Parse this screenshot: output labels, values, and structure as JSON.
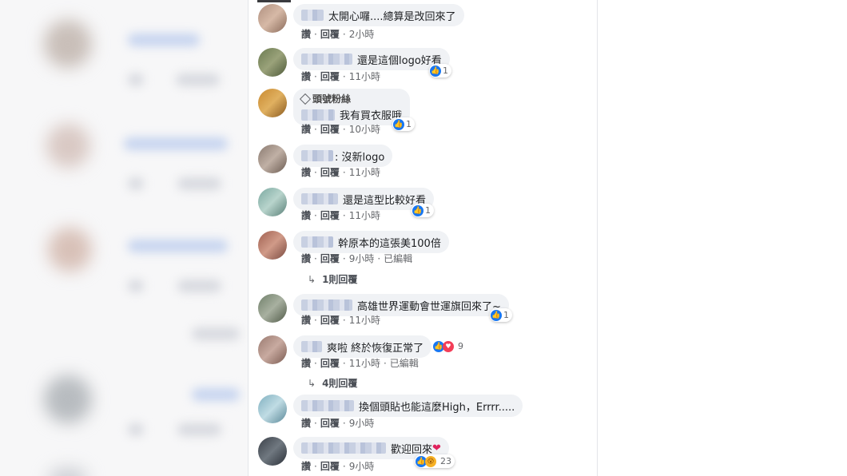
{
  "actions": {
    "like": "讚",
    "reply": "回覆",
    "dot": "·",
    "edited": "已編輯"
  },
  "comments": [
    {
      "badge": "",
      "text": "太開心囉....總算是改回來了",
      "time": "2小時",
      "reactions": ""
    },
    {
      "badge": "",
      "text": "還是這個logo好看",
      "time": "11小時",
      "reactions": "1"
    },
    {
      "badge": "頭號粉絲",
      "text": "我有買衣服哦",
      "time": "10小時",
      "reactions": "1"
    },
    {
      "badge": "",
      "text": ": 沒新logo",
      "time": "11小時",
      "reactions": ""
    },
    {
      "badge": "",
      "text": "還是這型比較好看",
      "time": "11小時",
      "reactions": "1"
    },
    {
      "badge": "",
      "text": "幹原本的這張美100倍",
      "time": "9小時",
      "reactions": "",
      "edited": true,
      "replies": "1則回覆"
    },
    {
      "badge": "",
      "text": "高雄世界運動會世運旗回來了~",
      "time": "11小時",
      "reactions": "1"
    },
    {
      "badge": "",
      "text": "爽啦 終於恢復正常了",
      "time": "11小時",
      "reactions": "9",
      "edited": true,
      "replies": "4則回覆"
    },
    {
      "badge": "",
      "text": "換個頭貼也能這麼High，Errrr.....",
      "time": "9小時",
      "reactions": ""
    },
    {
      "badge": "",
      "text": "歡迎回來",
      "emoji": "❤",
      "time": "9小時",
      "reactions": "23"
    }
  ],
  "colors": {
    "like_blue": "#1877f2",
    "love_red": "#f33e58",
    "bubble_bg": "#f0f2f5"
  },
  "icons": [
    "like-icon",
    "love-icon",
    "wow-icon",
    "reply-arrow-icon",
    "diamond-badge-icon"
  ]
}
